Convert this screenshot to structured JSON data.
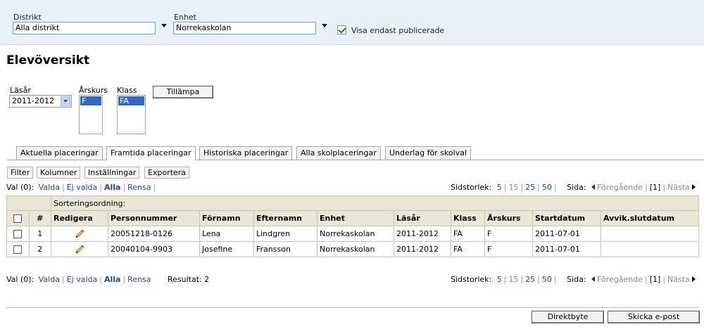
{
  "filters": {
    "distrikt_label": "Distrikt",
    "distrikt_value": "Alla distrikt",
    "enhet_label": "Enhet",
    "enhet_value": "Norrekaskolan",
    "visa_label": "Visa endast publicerade"
  },
  "page_title": "Elevöversikt",
  "selectors": {
    "lasar_label": "Läsår",
    "lasar_value": "2011-2012",
    "arskurs_label": "Årskurs",
    "arskurs_value": "F",
    "klass_label": "Klass",
    "klass_value": "FA",
    "apply_label": "Tillämpa"
  },
  "tabs": [
    "Aktuella placeringar",
    "Framtida placeringar",
    "Historiska placeringar",
    "Alla skolplaceringar",
    "Underlag för skolval"
  ],
  "subtabs": [
    "Filter",
    "Kolumner",
    "Inställningar",
    "Exportera"
  ],
  "selection": {
    "prefix": "Val (0):",
    "valda": "Valda",
    "ej_valda": "Ej valda",
    "alla": "Alla",
    "rensa": "Rensa",
    "resultat": "Resultat: 2"
  },
  "pager": {
    "sidstorlek": "Sidstorlek:",
    "sizes": [
      "5",
      "15",
      "25",
      "50"
    ],
    "sida": "Sida:",
    "prev": "Föregående",
    "current": "[1]",
    "next": "Nästa"
  },
  "table": {
    "sort_label": "Sorteringsordning:",
    "headers": [
      "#",
      "Redigera",
      "Personnummer",
      "Förnamn",
      "Efternamn",
      "Enhet",
      "Läsår",
      "Klass",
      "Årskurs",
      "Startdatum",
      "Avvik.slutdatum"
    ],
    "rows": [
      {
        "num": "1",
        "personnummer": "20051218-0126",
        "fornamn": "Lena",
        "efternamn": "Lindgren",
        "enhet": "Norrekaskolan",
        "lasar": "2011-2012",
        "klass": "FA",
        "arskurs": "F",
        "startdatum": "2011-07-01",
        "slutdatum": ""
      },
      {
        "num": "2",
        "personnummer": "20040104-9903",
        "fornamn": "Josefine",
        "efternamn": "Fransson",
        "enhet": "Norrekaskolan",
        "lasar": "2011-2012",
        "klass": "FA",
        "arskurs": "F",
        "startdatum": "2011-07-01",
        "slutdatum": ""
      }
    ]
  },
  "footer_buttons": {
    "direktbyte": "Direktbyte",
    "skicka": "Skicka e-post"
  }
}
